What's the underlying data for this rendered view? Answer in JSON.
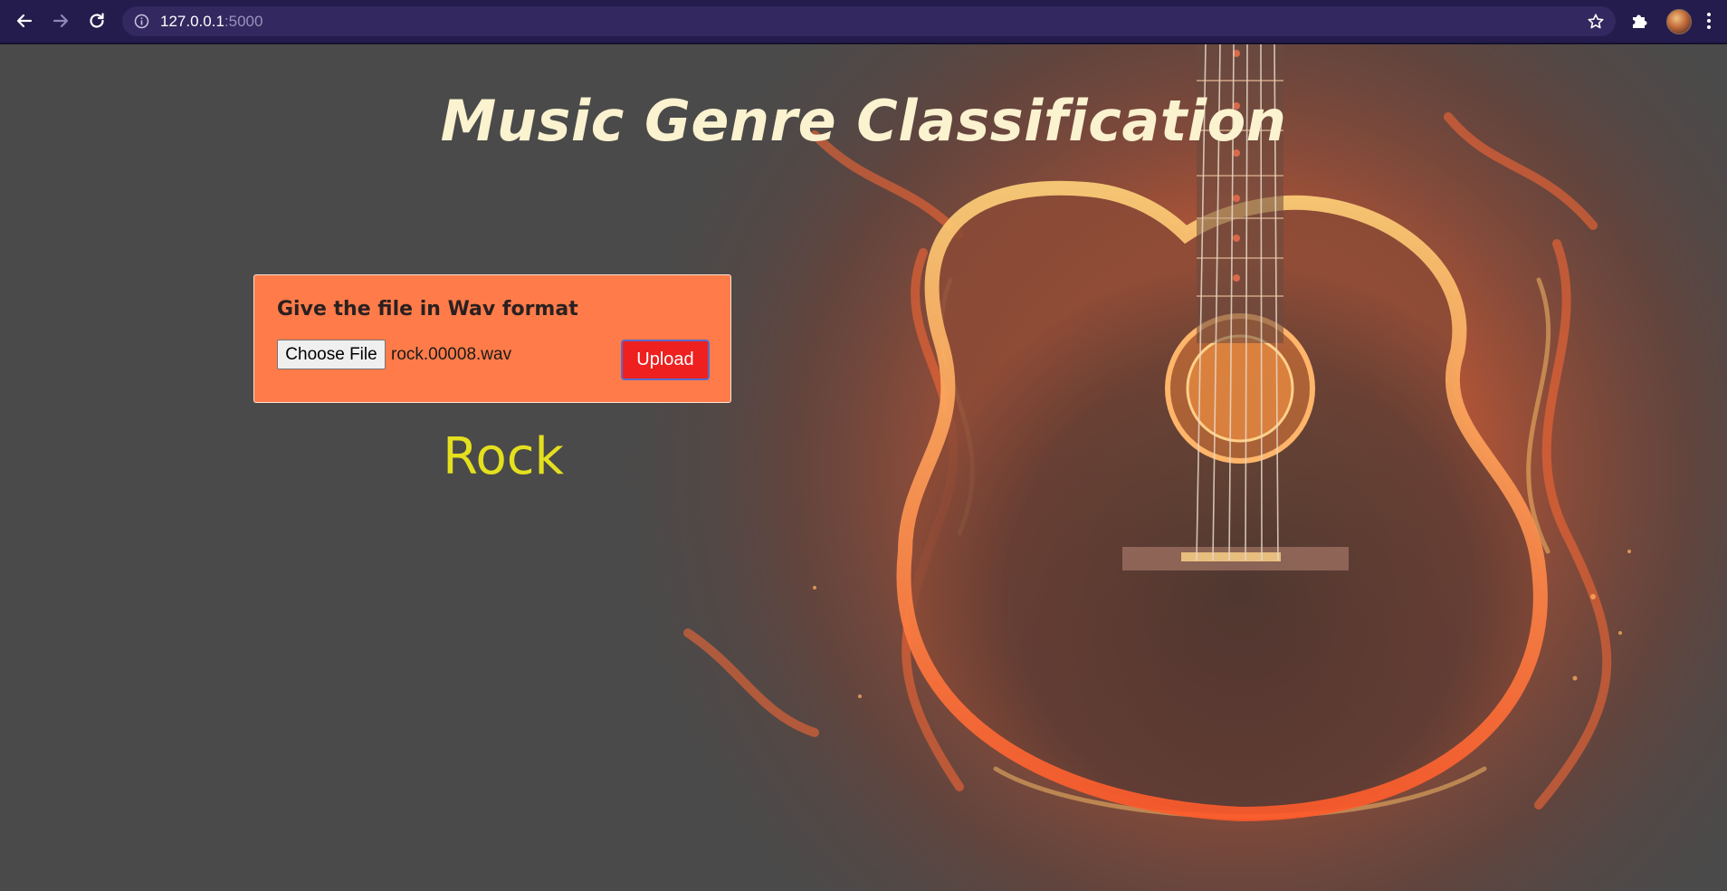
{
  "browser": {
    "url_host": "127.0.0.1",
    "url_port": ":5000",
    "icons": [
      "back-arrow-icon",
      "forward-arrow-icon",
      "reload-icon",
      "info-icon",
      "bookmark-star-icon",
      "extensions-puzzle-icon",
      "profile-avatar",
      "menu-dots-icon"
    ]
  },
  "page": {
    "title": "Music Genre Classification",
    "upload_form": {
      "instruction": "Give the file in Wav format",
      "choose_file_label": "Choose File",
      "selected_file": "rock.00008.wav",
      "upload_label": "Upload"
    },
    "prediction": "Rock"
  },
  "colors": {
    "chrome_bg": "#241c4c",
    "omnibox_bg": "#33285f",
    "page_bg": "#4a4a4a",
    "title": "#fbf2cf",
    "card_bg": "#ff7c4a",
    "upload_button": "#ee2020",
    "prediction_text": "#e4e01e"
  }
}
